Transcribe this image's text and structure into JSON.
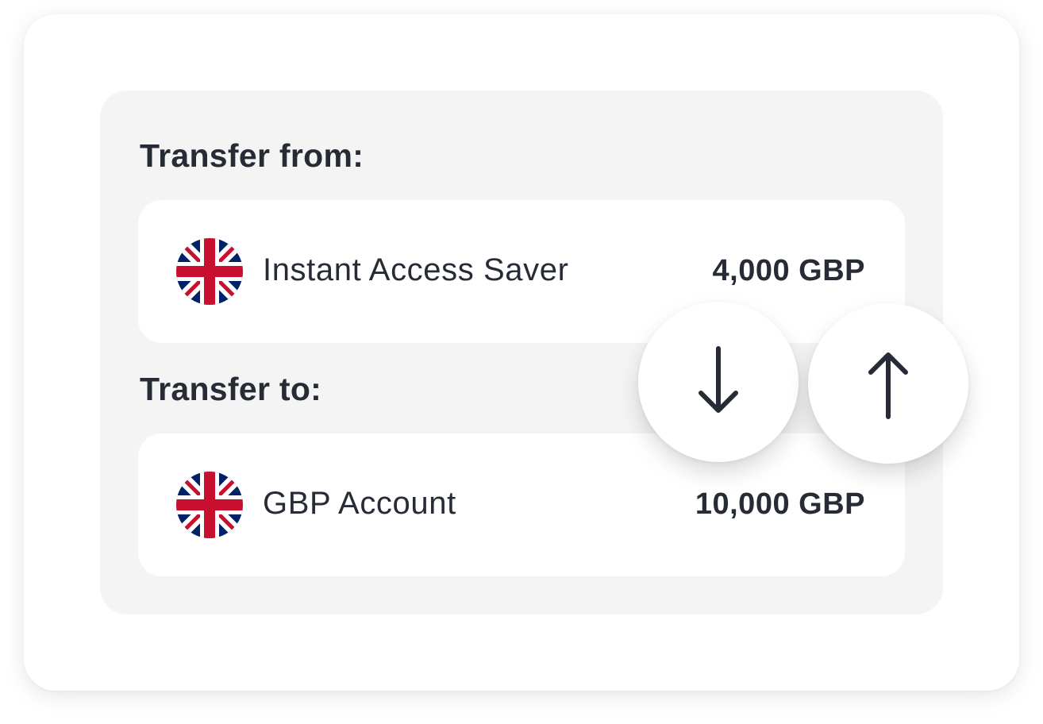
{
  "transfer": {
    "from_label": "Transfer from:",
    "to_label": "Transfer to:",
    "from_account": {
      "name": "Instant Access Saver",
      "amount": "4,000 GBP",
      "flag_icon": "uk-flag-icon"
    },
    "to_account": {
      "name": "GBP Account",
      "amount": "10,000 GBP",
      "flag_icon": "uk-flag-icon"
    }
  },
  "actions": {
    "down_icon": "arrow-down-icon",
    "up_icon": "arrow-up-icon"
  },
  "colors": {
    "text": "#262b36",
    "panel_bg": "#f4f4f4",
    "card_bg": "#ffffff",
    "flag_blue": "#012169",
    "flag_red": "#c8102e"
  }
}
